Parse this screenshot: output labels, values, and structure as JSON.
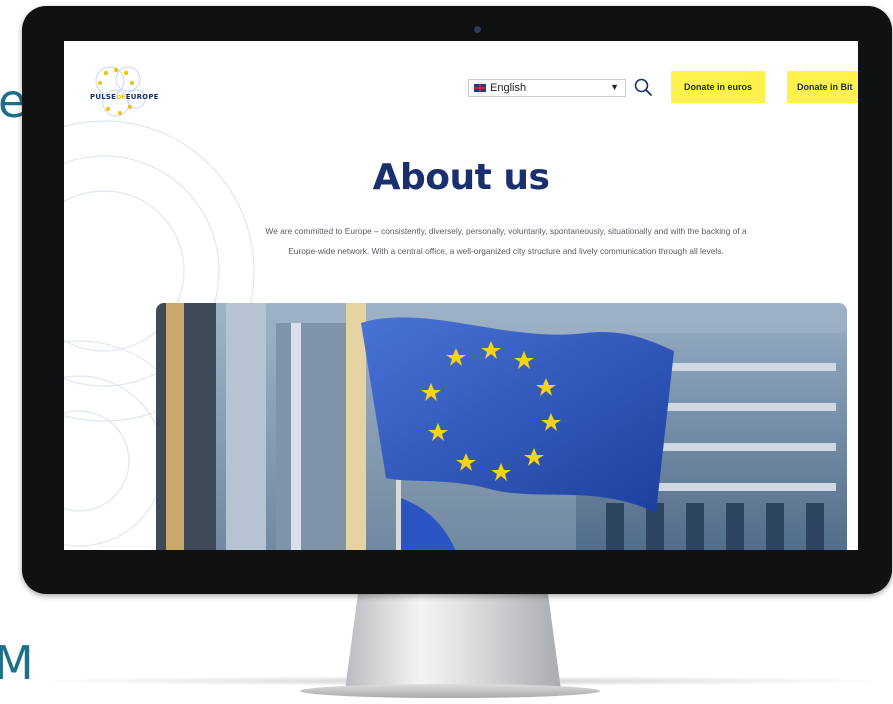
{
  "site": {
    "logo": {
      "text_pulse": "PULSE",
      "text_of": "OF",
      "text_europe": "EUROPE"
    },
    "language_select": {
      "selected": "English",
      "flag": "uk-flag-icon"
    },
    "search_icon": "search-icon",
    "buttons": {
      "donate_euros": "Donate in euros",
      "donate_bitcoin": "Donate in Bit"
    },
    "page_title": "About us",
    "intro_text": "We are committed to Europe – consistently, diversely, personally, voluntarily, spontaneously, situationally and with the backing of a Europe-wide network. With a central office, a well-organized city structure and lively communication through all levels.",
    "hero_image": "eu-flags-parliament-photo"
  },
  "background": {
    "letter_top": "e",
    "letter_bottom": "M"
  },
  "colors": {
    "brand_navy": "#1a2f6e",
    "button_yellow": "#fff24a",
    "monitor_bezel": "#101113"
  }
}
